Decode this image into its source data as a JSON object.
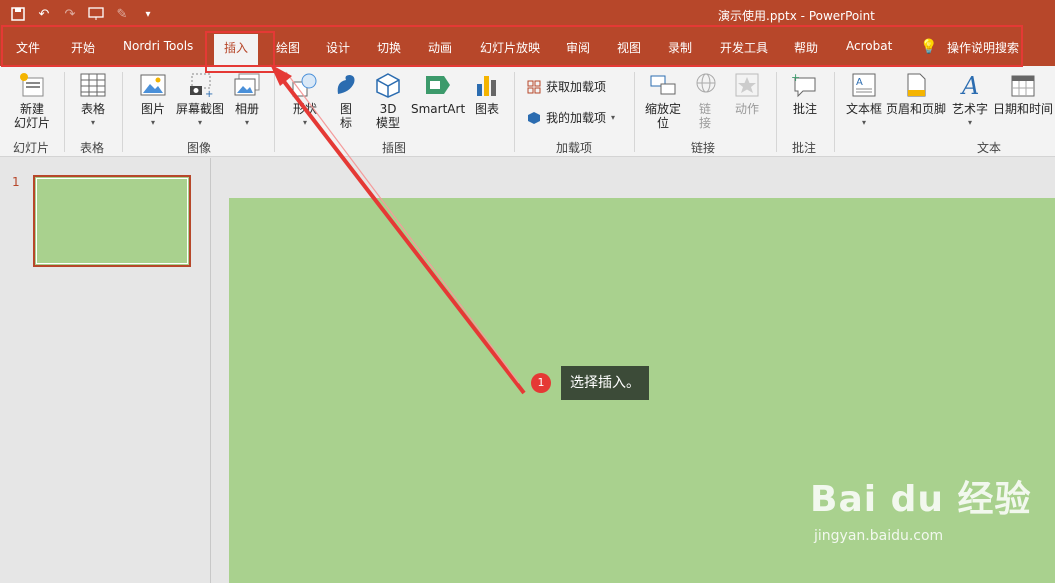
{
  "window": {
    "title": "演示使用.pptx  -  PowerPoint"
  },
  "qat": {
    "icons": [
      "save-icon",
      "undo-icon",
      "redo-icon",
      "start-slideshow-icon",
      "touch-mode-icon",
      "customize-qat-icon"
    ]
  },
  "tabs": [
    "文件",
    "开始",
    "Nordri Tools",
    "插入",
    "绘图",
    "设计",
    "切换",
    "动画",
    "幻灯片放映",
    "审阅",
    "视图",
    "录制",
    "开发工具",
    "帮助",
    "Acrobat"
  ],
  "active_tab": "插入",
  "tell_me": "操作说明搜索",
  "ribbon": {
    "slides": {
      "label": "幻灯片",
      "new_slide": "新建\n幻灯片"
    },
    "tables": {
      "label": "表格",
      "table": "表格"
    },
    "images": {
      "label": "图像",
      "pictures": "图片",
      "screenshot": "屏幕截图",
      "album": "相册"
    },
    "illustrations": {
      "label": "插图",
      "shapes": "形状",
      "icons": "图\n标",
      "models": "3D\n模型",
      "smartart": "SmartArt",
      "chart": "图表"
    },
    "addins": {
      "label": "加载项",
      "get": "获取加载项",
      "mine": "我的加载项"
    },
    "links": {
      "label": "链接",
      "zoom": "缩放定\n位",
      "link": "链\n接",
      "action": "动作"
    },
    "comments": {
      "label": "批注",
      "comment": "批注"
    },
    "text": {
      "label": "文本",
      "textbox": "文本框",
      "header_footer": "页眉和页脚",
      "wordart": "艺术字",
      "datetime": "日期和时间"
    }
  },
  "thumbnails": {
    "slide_number": "1"
  },
  "annotation": {
    "number": "1",
    "text": "选择插入。"
  },
  "watermark": {
    "brand": "Bai du 经验",
    "url": "jingyan.baidu.com"
  },
  "colors": {
    "accent": "#b7472a",
    "slide_bg": "#a9d18e",
    "annotation_red": "#e53935"
  }
}
